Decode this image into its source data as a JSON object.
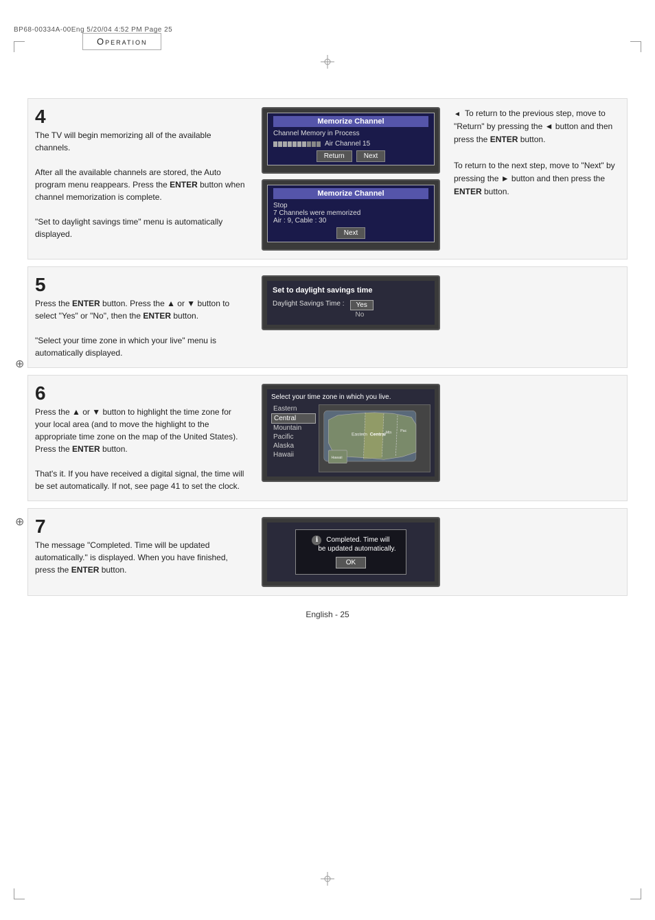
{
  "file_info": "BP68-00334A-00Eng   5/20/04   4:52 PM   Page 25",
  "header": {
    "title": "Operation"
  },
  "page_number": "English - 25",
  "sections": {
    "step4": {
      "number": "4",
      "text_parts": [
        "The TV will begin memorizing all of the available channels.",
        "After all the available channels are stored, the Auto program menu reappears. Press the ",
        "ENTER",
        " button when channel memorization is complete.",
        "“Set to daylight savings time” menu is automatically displayed."
      ],
      "screen1": {
        "title": "Memorize Channel",
        "line1": "Channel Memory in Process",
        "progress_filled": 7,
        "progress_total": 10,
        "channel_label": "Air Channel 15",
        "btn_return": "Return",
        "btn_next": "Next"
      },
      "screen2": {
        "title": "Memorize Channel",
        "line1": "Stop",
        "line2": "7 Channels were memorized",
        "line3": "Air : 9, Cable : 30",
        "btn_next": "Next"
      },
      "right_note": {
        "bullet": "◄",
        "para1": "To return to the previous step, move to “Return” by pressing the ◄ button and then press the ENTER button.",
        "para2": "To return to the next step, move to “Next” by pressing the ► button and then press the ENTER button."
      }
    },
    "step5": {
      "number": "5",
      "text_parts": [
        "Press the ",
        "ENTER",
        " button. Press the ▲ or ▼ button to select “Yes” or “No”, then the ",
        "ENTER",
        " button.",
        "“Select your time zone in which your live” menu is automatically displayed."
      ],
      "screen": {
        "title": "Set to daylight  savings time",
        "label": "Daylight Savings   Time :",
        "option_yes": "Yes",
        "option_no": "No"
      }
    },
    "step6": {
      "number": "6",
      "text_parts": [
        "Press the ▲ or ▼ button to highlight the time zone for your local area (and to move the highlight to the appropriate time zone on the map of the United States). Press the ",
        "ENTER",
        " button.",
        "That’s it. If you have received a digital signal, the time will be set automatically. If not, see page 41 to set the clock."
      ],
      "screen": {
        "title": "Select your time zone in which you live.",
        "zones": [
          "Eastern",
          "Central",
          "Mountain",
          "Pacific",
          "Alaska",
          "Hawaii"
        ],
        "selected": "Central"
      }
    },
    "step7": {
      "number": "7",
      "text_parts": [
        "The message “Completed. Time will be updated automatically.” is displayed. When you have finished, press the ",
        "ENTER",
        " button."
      ],
      "screen": {
        "message_line1": "Completed. Time will",
        "message_line2": "be updated automatically.",
        "btn_ok": "OK"
      }
    }
  }
}
